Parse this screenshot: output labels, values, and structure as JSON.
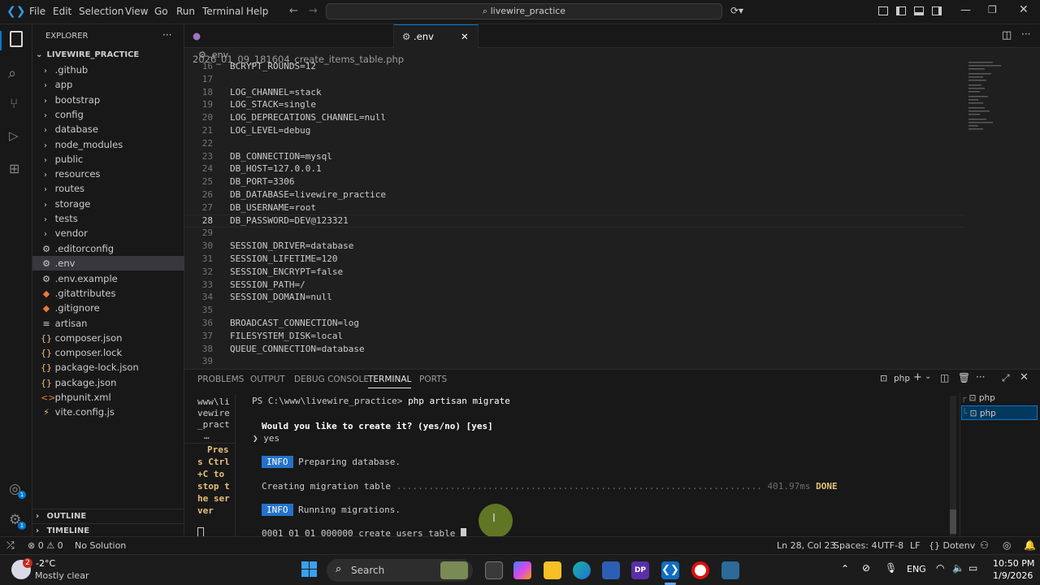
{
  "menu": [
    "File",
    "Edit",
    "Selection",
    "View",
    "Go",
    "Run",
    "Terminal",
    "Help"
  ],
  "search": {
    "text": "livewire_practice"
  },
  "sidebar": {
    "title": "EXPLORER",
    "project": "LIVEWIRE_PRACTICE",
    "folders": [
      ".github",
      "app",
      "bootstrap",
      "config",
      "database",
      "node_modules",
      "public",
      "resources",
      "routes",
      "storage",
      "tests",
      "vendor"
    ],
    "files": [
      ".editorconfig",
      ".env",
      ".env.example",
      ".gitattributes",
      ".gitignore",
      "artisan",
      "composer.json",
      "composer.lock",
      "package-lock.json",
      "package.json",
      "phpunit.xml",
      "vite.config.js"
    ],
    "outline": "OUTLINE",
    "timeline": "TIMELINE"
  },
  "tabs": [
    {
      "label": "2026_01_09_181604_create_items_table.php"
    },
    {
      "label": ".env"
    }
  ],
  "breadcrumb": ".env",
  "code_lines": [
    {
      "n": "16",
      "t": "BCRYPT_ROUNDS=12"
    },
    {
      "n": "17",
      "t": ""
    },
    {
      "n": "18",
      "t": "LOG_CHANNEL=stack"
    },
    {
      "n": "19",
      "t": "LOG_STACK=single"
    },
    {
      "n": "20",
      "t": "LOG_DEPRECATIONS_CHANNEL=null"
    },
    {
      "n": "21",
      "t": "LOG_LEVEL=debug"
    },
    {
      "n": "22",
      "t": ""
    },
    {
      "n": "23",
      "t": "DB_CONNECTION=mysql"
    },
    {
      "n": "24",
      "t": "DB_HOST=127.0.0.1"
    },
    {
      "n": "25",
      "t": "DB_PORT=3306"
    },
    {
      "n": "26",
      "t": "DB_DATABASE=livewire_practice"
    },
    {
      "n": "27",
      "t": "DB_USERNAME=root"
    },
    {
      "n": "28",
      "t": "DB_PASSWORD=DEV@123321"
    },
    {
      "n": "29",
      "t": ""
    },
    {
      "n": "30",
      "t": "SESSION_DRIVER=database"
    },
    {
      "n": "31",
      "t": "SESSION_LIFETIME=120"
    },
    {
      "n": "32",
      "t": "SESSION_ENCRYPT=false"
    },
    {
      "n": "33",
      "t": "SESSION_PATH=/"
    },
    {
      "n": "34",
      "t": "SESSION_DOMAIN=null"
    },
    {
      "n": "35",
      "t": ""
    },
    {
      "n": "36",
      "t": "BROADCAST_CONNECTION=log"
    },
    {
      "n": "37",
      "t": "FILESYSTEM_DISK=local"
    },
    {
      "n": "38",
      "t": "QUEUE_CONNECTION=database"
    },
    {
      "n": "39",
      "t": ""
    }
  ],
  "panel": {
    "tabs": [
      "PROBLEMS",
      "OUTPUT",
      "DEBUG CONSOLE",
      "TERMINAL",
      "PORTS"
    ],
    "shell_label": "php",
    "terminals": [
      "php",
      "php"
    ],
    "left_pane": [
      "www\\li",
      "vewire",
      "_pract",
      "…"
    ],
    "left_hint": [
      "Pres",
      "s Ctrl",
      "+C to",
      "stop t",
      "he ser",
      "ver"
    ],
    "prompt": "PS C:\\www\\livewire_practice> ",
    "command": "php artisan migrate",
    "question": "Would you like to create it? (yes/no) [yes]",
    "answer": "yes",
    "info1_badge": "INFO",
    "info1": "Preparing database.",
    "creating": "Creating migration table ",
    "dots": "....................................................................",
    "time": "401.97ms",
    "done": "DONE",
    "info2_badge": "INFO",
    "info2": "Running migrations.",
    "migration": "0001_01_01_000000_create_users_table "
  },
  "status": {
    "errors": "0",
    "warnings": "0",
    "solution": "No Solution",
    "position": "Ln 28, Col 23",
    "spaces": "Spaces: 4",
    "encoding": "UTF-8",
    "eol": "LF",
    "language": "Dotenv"
  },
  "taskbar": {
    "weather_temp": "-2°C",
    "weather_desc": "Mostly clear",
    "weather_badge": "2",
    "search": "Search",
    "lang": "ENG",
    "time": "10:50 PM",
    "date": "1/9/2026"
  }
}
